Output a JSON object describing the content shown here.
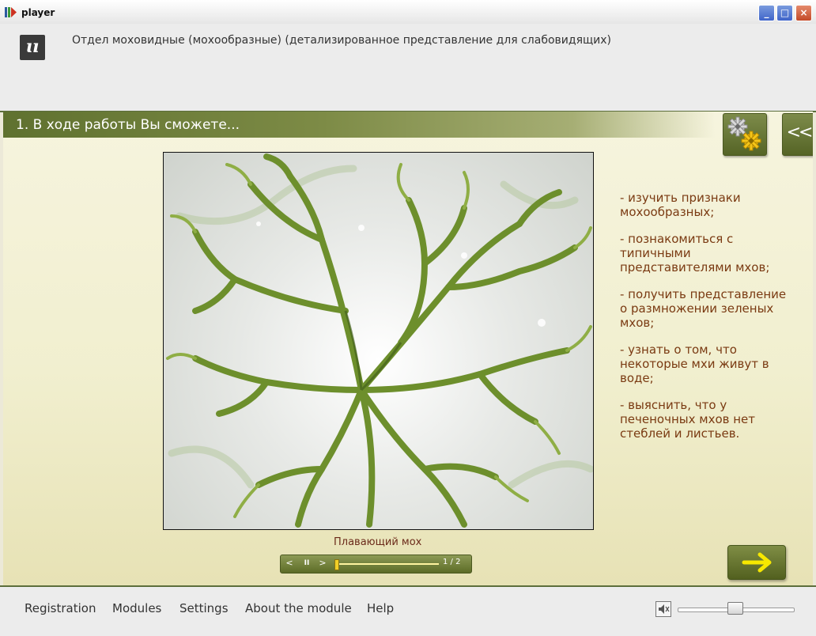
{
  "window": {
    "title": "player",
    "min_label": "_",
    "max_label": "□",
    "close_label": "×"
  },
  "header": {
    "logo_text": "ɩı",
    "module_title": "Отдел моховидные (мохообразные) (детализированное представление для слабовидящих)"
  },
  "section": {
    "title": "1. В ходе работы Вы сможете...",
    "back_label": "<<"
  },
  "media": {
    "caption": "Плавающий мох",
    "prev": "<",
    "pause": "II",
    "next": ">",
    "counter": "1 / 2",
    "progress": 0.0
  },
  "objectives": [
    "- изучить признаки мохообразных;",
    "- познакомиться с типичными представителями мхов;",
    "- получить представление о размножении зеленых мхов;",
    "- узнать о том, что некоторые мхи живут в воде;",
    "- выяснить, что у печеночных мхов нет стеблей и листьев."
  ],
  "footer": {
    "menu": [
      "Registration",
      "Modules",
      "Settings",
      "About the module",
      "Help"
    ],
    "volume": 0.5
  },
  "colors": {
    "accent": "#5f712f",
    "text": "#7a3a12",
    "arrow": "#f7e800"
  }
}
